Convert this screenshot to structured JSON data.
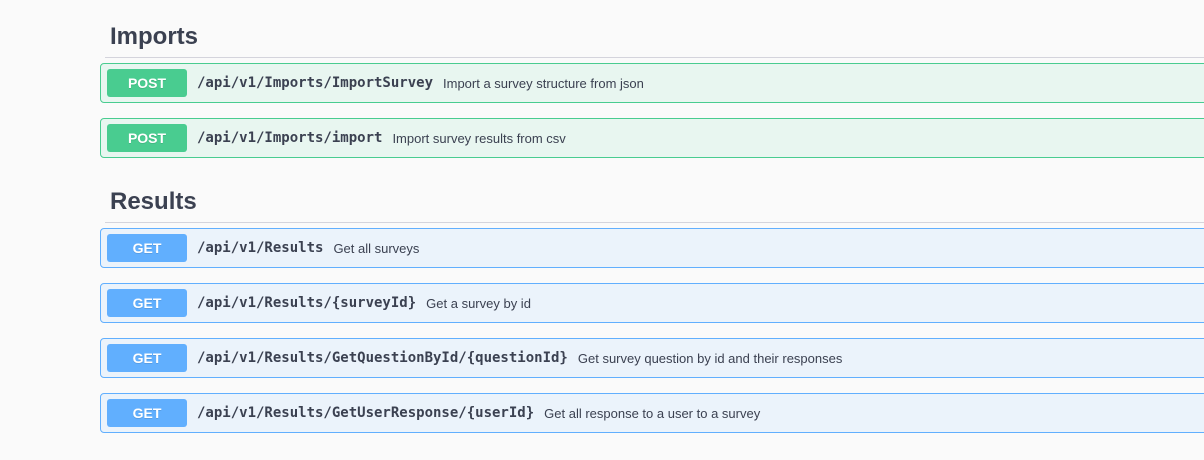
{
  "sections": [
    {
      "title": "Imports",
      "operations": [
        {
          "method": "POST",
          "path": "/api/v1/Imports/ImportSurvey",
          "summary": "Import a survey structure from json"
        },
        {
          "method": "POST",
          "path": "/api/v1/Imports/import",
          "summary": "Import survey results from csv"
        }
      ]
    },
    {
      "title": "Results",
      "operations": [
        {
          "method": "GET",
          "path": "/api/v1/Results",
          "summary": "Get all surveys"
        },
        {
          "method": "GET",
          "path": "/api/v1/Results/{surveyId}",
          "summary": "Get a survey by id"
        },
        {
          "method": "GET",
          "path": "/api/v1/Results/GetQuestionById/{questionId}",
          "summary": "Get survey question by id and their responses"
        },
        {
          "method": "GET",
          "path": "/api/v1/Results/GetUserResponse/{userId}",
          "summary": "Get all response to a user to a survey"
        }
      ]
    }
  ],
  "colors": {
    "post_accent": "#49cc90",
    "post_background": "#e8f6f0",
    "get_accent": "#61affe",
    "get_background": "#ebf3fb",
    "text": "#3b4151"
  }
}
